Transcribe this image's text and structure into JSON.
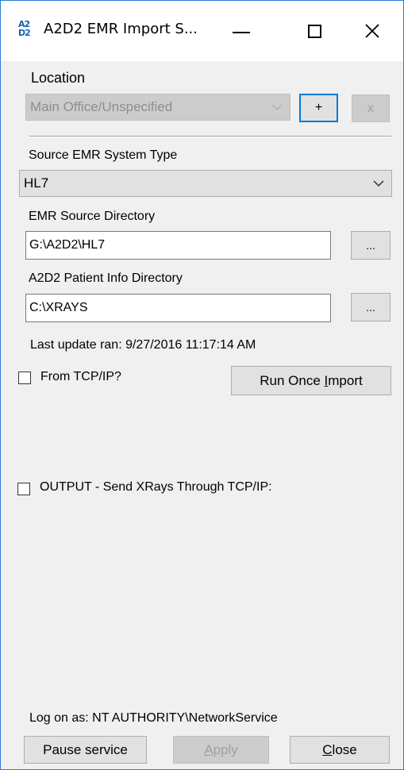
{
  "window": {
    "title": "A2D2 EMR Import S...",
    "icon_label_top": "A2",
    "icon_label_bottom": "D2",
    "icon": "a2d2-app-icon"
  },
  "location": {
    "label": "Location",
    "selected": "Main Office/Unspecified",
    "add_label": "+",
    "remove_label": "x"
  },
  "source_type": {
    "label": "Source EMR System Type",
    "selected": "HL7"
  },
  "source_dir": {
    "label": "EMR Source Directory",
    "value": "G:\\A2D2\\HL7",
    "browse_label": "..."
  },
  "patient_dir": {
    "label": "A2D2 Patient Info Directory",
    "value": "C:\\XRAYS",
    "browse_label": "..."
  },
  "last_update": "Last update ran: 9/27/2016 11:17:14 AM",
  "from_tcpip": {
    "label": "From TCP/IP?",
    "checked": false
  },
  "run_once": {
    "label_pre": "Run Once ",
    "label_u": "I",
    "label_post": "mport"
  },
  "output_tcpip": {
    "label": "OUTPUT - Send XRays Through TCP/IP:",
    "checked": false
  },
  "log_on": "Log on as: NT AUTHORITY\\NetworkService",
  "footer": {
    "pause_label": "Pause service",
    "apply_u": "A",
    "apply_rest": "pply",
    "close_u": "C",
    "close_rest": "lose"
  },
  "colors": {
    "accent": "#0078d7",
    "window_border": "#2b7bd6",
    "background": "#f0f0f0"
  }
}
